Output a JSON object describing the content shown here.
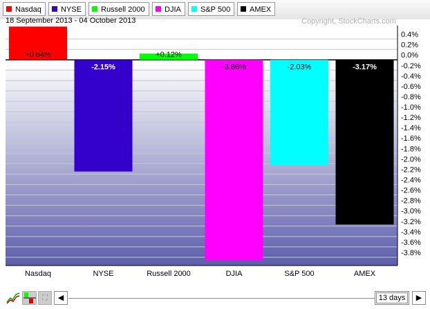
{
  "legend": [
    {
      "label": "Nasdaq",
      "color": "#ff0000"
    },
    {
      "label": "NYSE",
      "color": "#3300cc"
    },
    {
      "label": "Russell 2000",
      "color": "#00ff00"
    },
    {
      "label": "DJIA",
      "color": "#ff00ff"
    },
    {
      "label": "S&P 500",
      "color": "#00ffff"
    },
    {
      "label": "AMEX",
      "color": "#000000"
    }
  ],
  "date_range": "18 September 2013 - 04 October 2013",
  "copyright": "Copyright, StockCharts.com",
  "chart_data": {
    "type": "bar",
    "categories": [
      "Nasdaq",
      "NYSE",
      "Russell 2000",
      "DJIA",
      "S&P 500",
      "AMEX"
    ],
    "values": [
      0.64,
      -2.15,
      0.12,
      -3.86,
      -2.03,
      -3.17
    ],
    "value_labels": [
      "+0.64%",
      "-2.15%",
      "+0.12%",
      "-3.86%",
      "-2.03%",
      "-3.17%"
    ],
    "colors": [
      "#ff0000",
      "#3300cc",
      "#00ff00",
      "#ff00ff",
      "#00ffff",
      "#000000"
    ],
    "ylim": [
      -3.96,
      0.66
    ],
    "yticks": [
      0.4,
      0.2,
      0.0,
      -0.2,
      -0.4,
      -0.6,
      -0.8,
      -1.0,
      -1.2,
      -1.4,
      -1.6,
      -1.8,
      -2.0,
      -2.2,
      -2.4,
      -2.6,
      -2.8,
      -3.0,
      -3.2,
      -3.4,
      -3.6,
      -3.8
    ],
    "ytick_labels": [
      "0.4%",
      "0.2%",
      "0.0%",
      "-0.2%",
      "-0.4%",
      "-0.6%",
      "-0.8%",
      "-1.0%",
      "-1.2%",
      "-1.4%",
      "-1.6%",
      "-1.8%",
      "-2.0%",
      "-2.2%",
      "-2.4%",
      "-2.6%",
      "-2.8%",
      "-3.0%",
      "-3.2%",
      "-3.4%",
      "-3.6%",
      "-3.8%"
    ],
    "grid": true
  },
  "period": "13 days"
}
